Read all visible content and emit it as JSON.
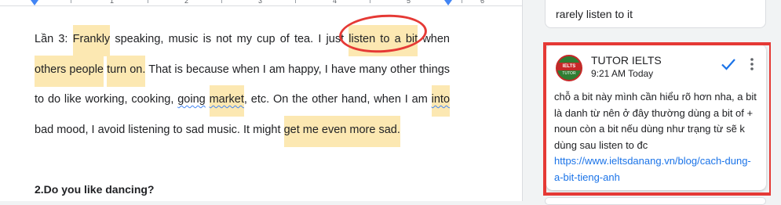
{
  "ruler": {
    "numbers": [
      "1",
      "2",
      "3",
      "4",
      "5",
      "6"
    ]
  },
  "document": {
    "paragraph": [
      {
        "t": "Lần 3: "
      },
      {
        "t": "Frankly",
        "hl": true
      },
      {
        "t": " speaking, music is not my cup of tea. I just "
      },
      {
        "t": "listen to a bit",
        "hl": true
      },
      {
        "t": " when "
      },
      {
        "t": "others people",
        "hl": true
      },
      {
        "t": " "
      },
      {
        "t": "turn on.",
        "hl": true
      },
      {
        "t": " That is because when I am happy, I have many other things to do like working, cooking, "
      },
      {
        "t": "going",
        "sq": true
      },
      {
        "t": " "
      },
      {
        "t": "market",
        "hl": true,
        "sq": true
      },
      {
        "t": ", etc. On the other hand, when I am "
      },
      {
        "t": "into",
        "hl": true,
        "sq": true
      },
      {
        "t": " bad mood, I avoid listening to sad music. It might "
      },
      {
        "t": "get me even more sad.",
        "hl": true
      }
    ],
    "heading": "2.Do you like dancing?"
  },
  "comments": {
    "previous_snippet": "rarely listen to it",
    "main": {
      "avatar_top": "IELTS",
      "avatar_bottom": "TUTOR",
      "author": "TUTOR IELTS",
      "time": "9:21 AM Today",
      "body": "chỗ a bit này mình cần hiểu rõ hơn nha, a bit là danh từ nên ở đây thường dùng a bit of + noun còn a bit nếu dùng như trạng từ sẽ k dùng sau listen to đc ",
      "link": "https://www.ieltsdanang.vn/blog/cach-dung-a-bit-tieng-anh"
    }
  },
  "colors": {
    "highlight": "#fce8b2",
    "annotation_red": "#e53935",
    "link_blue": "#1a73e8",
    "check_blue": "#1a73e8"
  }
}
